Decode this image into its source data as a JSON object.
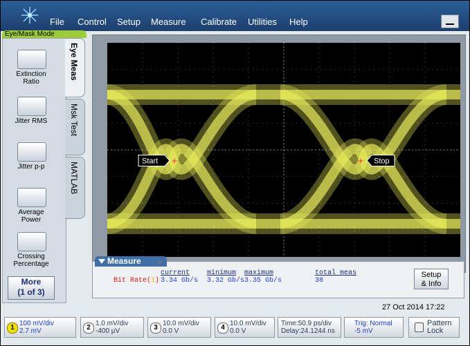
{
  "menu": {
    "items": [
      "File",
      "Control",
      "Setup",
      "Measure",
      "Calibrate",
      "Utilities",
      "Help"
    ]
  },
  "mode_tab": "Eye/Mask Mode",
  "side_tabs": [
    "Eye Meas",
    "Msk Test",
    "MATLAB"
  ],
  "measurements_buttons": [
    {
      "label": "Extinction Ratio",
      "icon": "extinction-ratio-icon"
    },
    {
      "label": "Jitter RMS",
      "icon": "jitter-rms-icon"
    },
    {
      "label": "Jitter p-p",
      "icon": "jitter-pp-icon"
    },
    {
      "label": "Average Power",
      "icon": "average-power-icon"
    },
    {
      "label": "Crossing Percentage",
      "icon": "crossing-percentage-icon"
    }
  ],
  "more_button": {
    "line1": "More",
    "line2": "(1 of 3)"
  },
  "markers": {
    "start": "Start",
    "stop": "Stop"
  },
  "measure_panel": {
    "title": "Measure",
    "headers": [
      "current",
      "minimum",
      "maximum",
      "total meas"
    ],
    "row": {
      "name": "Bit Rate(",
      "channel": "1",
      "close": ")",
      "current": "3.34 Gb/s",
      "minimum": "3.32 Gb/s",
      "maximum": "3.35 Gb/s",
      "total": "38"
    },
    "setup_button": {
      "line1": "Setup",
      "line2": "& Info"
    }
  },
  "datetime": "27 Oct 2014   17:22",
  "status_bar": {
    "channels": [
      {
        "num": "1",
        "line1": "100 mV/div",
        "line2": "2.7 mV",
        "active": true
      },
      {
        "num": "2",
        "line1": "1.0 mV/div",
        "line2": "-400 µV",
        "active": false
      },
      {
        "num": "3",
        "line1": "10.0 mV/div",
        "line2": "0.0 V",
        "active": false
      },
      {
        "num": "4",
        "line1": "10.0 mV/div",
        "line2": "0.0 V",
        "active": false
      }
    ],
    "time": {
      "line1": "Time:50.9 ps/div",
      "line2": "Delay:24.1244 ns"
    },
    "trigger": {
      "line1": "Trig: Normal",
      "line2": "-5 mV"
    },
    "pattern_lock": {
      "line1": "Pattern",
      "line2": "Lock"
    }
  },
  "colors": {
    "trace": "#e6e95a",
    "menubar": "#2a5f99",
    "measure_tab": "#3f6fa7",
    "mode_tab": "#9ccc3c"
  }
}
